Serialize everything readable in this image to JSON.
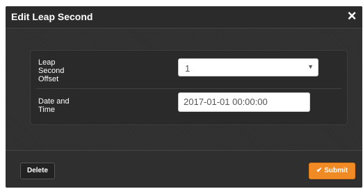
{
  "dialog": {
    "title": "Edit Leap Second",
    "close_icon": "×"
  },
  "form": {
    "leap_offset": {
      "label_lines": [
        "Leap",
        "Second",
        "Offset"
      ],
      "value": "1",
      "arrow_icon": "▼"
    },
    "date_time": {
      "label_lines": [
        "Date and",
        "Time"
      ],
      "value": "2017-01-01 00:00:00"
    }
  },
  "footer": {
    "delete_label": "Delete",
    "submit_label": "Submit",
    "submit_icon": "✔"
  },
  "colors": {
    "submit_accent": "#f08a24",
    "modal_background": "#2f2f2f"
  }
}
